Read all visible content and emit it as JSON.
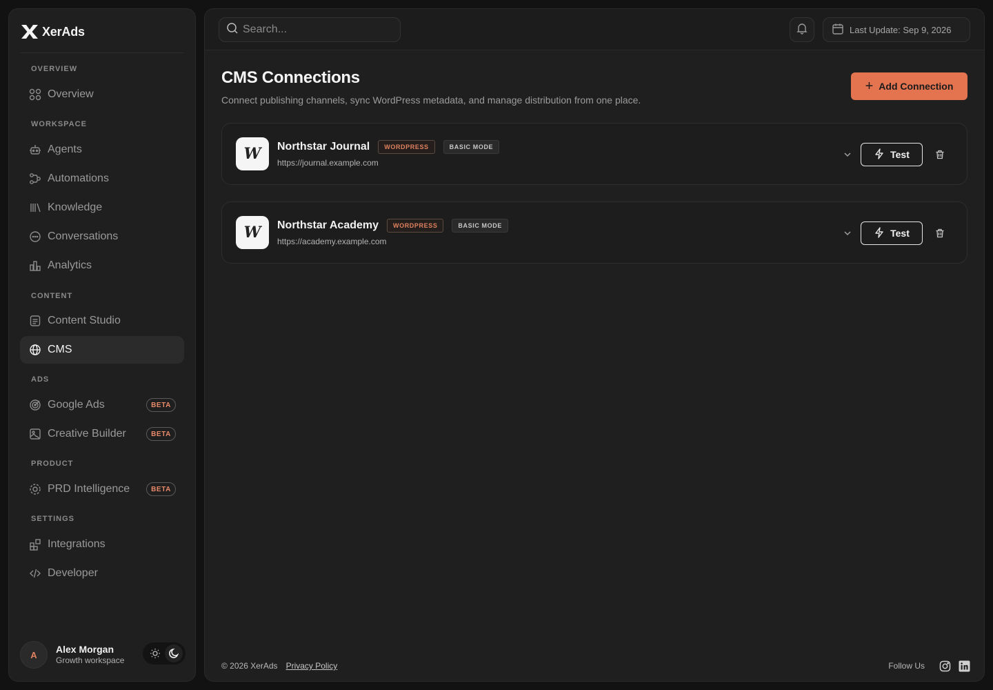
{
  "brand": {
    "name": "XerAds"
  },
  "sidebar": {
    "sections": {
      "overview": "OVERVIEW",
      "workspace": "WORKSPACE",
      "content": "CONTENT",
      "ads": "ADS",
      "product": "PRODUCT",
      "settings": "SETTINGS"
    },
    "items": {
      "overview": {
        "label": "Overview",
        "icon": "grid-icon"
      },
      "agents": {
        "label": "Agents",
        "icon": "robot-icon"
      },
      "automations": {
        "label": "Automations",
        "icon": "workflow-icon"
      },
      "knowledge": {
        "label": "Knowledge",
        "icon": "library-icon"
      },
      "conversations": {
        "label": "Conversations",
        "icon": "chat-icon"
      },
      "analytics": {
        "label": "Analytics",
        "icon": "bar-chart-icon"
      },
      "content_studio": {
        "label": "Content Studio",
        "icon": "document-icon"
      },
      "cms": {
        "label": "CMS",
        "icon": "globe-icon",
        "active": true
      },
      "google_ads": {
        "label": "Google Ads",
        "icon": "target-icon",
        "badge": "BETA"
      },
      "creative_builder": {
        "label": "Creative Builder",
        "icon": "image-icon",
        "badge": "BETA"
      },
      "prd_intelligence": {
        "label": "PRD Intelligence",
        "icon": "cog-icon",
        "badge": "BETA"
      },
      "integrations": {
        "label": "Integrations",
        "icon": "blocks-icon"
      },
      "developer": {
        "label": "Developer",
        "icon": "code-icon"
      }
    },
    "user": {
      "initial": "A",
      "name": "Alex Morgan",
      "workspace": "Growth workspace"
    }
  },
  "topbar": {
    "search_placeholder": "Search...",
    "last_update": "Last Update: Sep 9, 2026"
  },
  "page": {
    "title": "CMS Connections",
    "subtitle": "Connect publishing channels, sync WordPress metadata, and manage distribution from one place.",
    "add_button": "Add Connection"
  },
  "connections": [
    {
      "logo": "W",
      "name": "Northstar Journal",
      "platform_tag": "WORDPRESS",
      "mode_tag": "BASIC MODE",
      "url": "https://journal.example.com",
      "test_label": "Test"
    },
    {
      "logo": "W",
      "name": "Northstar Academy",
      "platform_tag": "WORDPRESS",
      "mode_tag": "BASIC MODE",
      "url": "https://academy.example.com",
      "test_label": "Test"
    }
  ],
  "footer": {
    "copyright": "© 2026 XerAds",
    "privacy": "Privacy Policy",
    "follow": "Follow Us"
  },
  "colors": {
    "accent": "#e4734f",
    "background": "#121212",
    "panel": "#1f1f1f"
  }
}
